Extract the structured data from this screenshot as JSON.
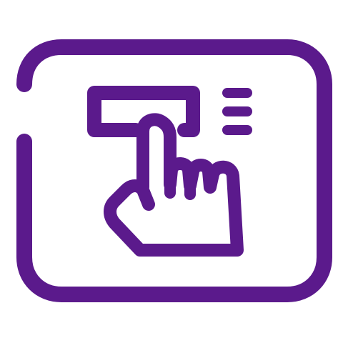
{
  "icon": {
    "name": "touch-input-field-icon",
    "color": "#5b1a8c",
    "background": "#ffffff",
    "parts": [
      "frame",
      "input-box",
      "text-lines",
      "pointing-hand"
    ]
  }
}
